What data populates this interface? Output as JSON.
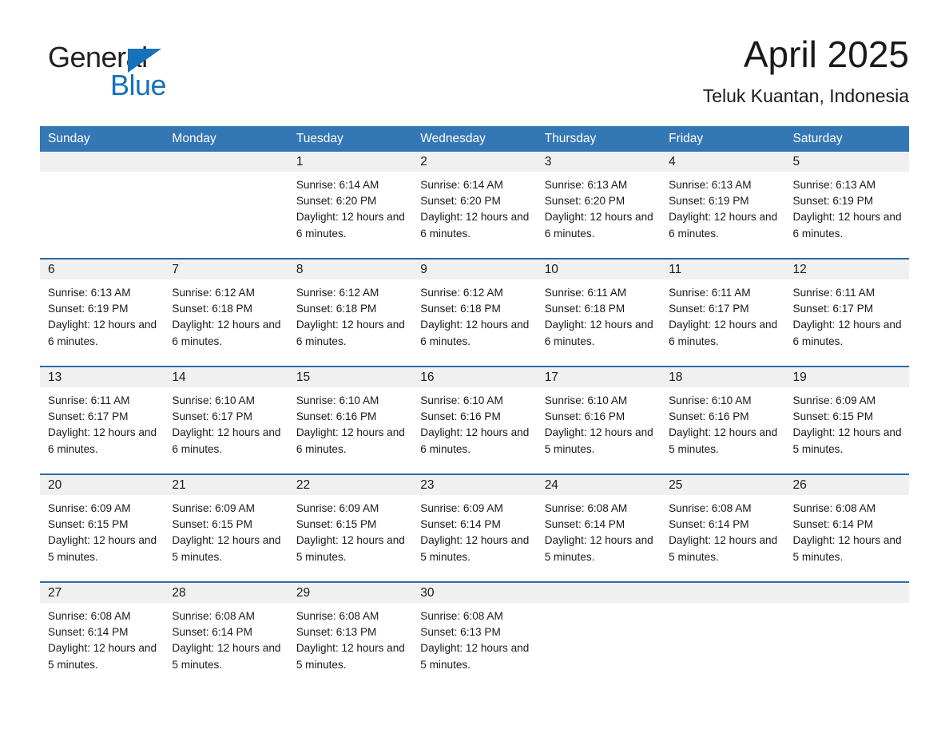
{
  "brand": {
    "name_part1": "General",
    "name_part2": "Blue",
    "triangle_color": "#1572b8",
    "accent_color": "#3477b5"
  },
  "header": {
    "month_title": "April 2025",
    "location": "Teluk Kuantan, Indonesia"
  },
  "calendar": {
    "weekday_headers": [
      "Sunday",
      "Monday",
      "Tuesday",
      "Wednesday",
      "Thursday",
      "Friday",
      "Saturday"
    ],
    "weeks": [
      [
        {
          "empty": true
        },
        {
          "empty": true
        },
        {
          "day": "1",
          "sunrise": "Sunrise: 6:14 AM",
          "sunset": "Sunset: 6:20 PM",
          "daylight": "Daylight: 12 hours and 6 minutes."
        },
        {
          "day": "2",
          "sunrise": "Sunrise: 6:14 AM",
          "sunset": "Sunset: 6:20 PM",
          "daylight": "Daylight: 12 hours and 6 minutes."
        },
        {
          "day": "3",
          "sunrise": "Sunrise: 6:13 AM",
          "sunset": "Sunset: 6:20 PM",
          "daylight": "Daylight: 12 hours and 6 minutes."
        },
        {
          "day": "4",
          "sunrise": "Sunrise: 6:13 AM",
          "sunset": "Sunset: 6:19 PM",
          "daylight": "Daylight: 12 hours and 6 minutes."
        },
        {
          "day": "5",
          "sunrise": "Sunrise: 6:13 AM",
          "sunset": "Sunset: 6:19 PM",
          "daylight": "Daylight: 12 hours and 6 minutes."
        }
      ],
      [
        {
          "day": "6",
          "sunrise": "Sunrise: 6:13 AM",
          "sunset": "Sunset: 6:19 PM",
          "daylight": "Daylight: 12 hours and 6 minutes."
        },
        {
          "day": "7",
          "sunrise": "Sunrise: 6:12 AM",
          "sunset": "Sunset: 6:18 PM",
          "daylight": "Daylight: 12 hours and 6 minutes."
        },
        {
          "day": "8",
          "sunrise": "Sunrise: 6:12 AM",
          "sunset": "Sunset: 6:18 PM",
          "daylight": "Daylight: 12 hours and 6 minutes."
        },
        {
          "day": "9",
          "sunrise": "Sunrise: 6:12 AM",
          "sunset": "Sunset: 6:18 PM",
          "daylight": "Daylight: 12 hours and 6 minutes."
        },
        {
          "day": "10",
          "sunrise": "Sunrise: 6:11 AM",
          "sunset": "Sunset: 6:18 PM",
          "daylight": "Daylight: 12 hours and 6 minutes."
        },
        {
          "day": "11",
          "sunrise": "Sunrise: 6:11 AM",
          "sunset": "Sunset: 6:17 PM",
          "daylight": "Daylight: 12 hours and 6 minutes."
        },
        {
          "day": "12",
          "sunrise": "Sunrise: 6:11 AM",
          "sunset": "Sunset: 6:17 PM",
          "daylight": "Daylight: 12 hours and 6 minutes."
        }
      ],
      [
        {
          "day": "13",
          "sunrise": "Sunrise: 6:11 AM",
          "sunset": "Sunset: 6:17 PM",
          "daylight": "Daylight: 12 hours and 6 minutes."
        },
        {
          "day": "14",
          "sunrise": "Sunrise: 6:10 AM",
          "sunset": "Sunset: 6:17 PM",
          "daylight": "Daylight: 12 hours and 6 minutes."
        },
        {
          "day": "15",
          "sunrise": "Sunrise: 6:10 AM",
          "sunset": "Sunset: 6:16 PM",
          "daylight": "Daylight: 12 hours and 6 minutes."
        },
        {
          "day": "16",
          "sunrise": "Sunrise: 6:10 AM",
          "sunset": "Sunset: 6:16 PM",
          "daylight": "Daylight: 12 hours and 6 minutes."
        },
        {
          "day": "17",
          "sunrise": "Sunrise: 6:10 AM",
          "sunset": "Sunset: 6:16 PM",
          "daylight": "Daylight: 12 hours and 5 minutes."
        },
        {
          "day": "18",
          "sunrise": "Sunrise: 6:10 AM",
          "sunset": "Sunset: 6:16 PM",
          "daylight": "Daylight: 12 hours and 5 minutes."
        },
        {
          "day": "19",
          "sunrise": "Sunrise: 6:09 AM",
          "sunset": "Sunset: 6:15 PM",
          "daylight": "Daylight: 12 hours and 5 minutes."
        }
      ],
      [
        {
          "day": "20",
          "sunrise": "Sunrise: 6:09 AM",
          "sunset": "Sunset: 6:15 PM",
          "daylight": "Daylight: 12 hours and 5 minutes."
        },
        {
          "day": "21",
          "sunrise": "Sunrise: 6:09 AM",
          "sunset": "Sunset: 6:15 PM",
          "daylight": "Daylight: 12 hours and 5 minutes."
        },
        {
          "day": "22",
          "sunrise": "Sunrise: 6:09 AM",
          "sunset": "Sunset: 6:15 PM",
          "daylight": "Daylight: 12 hours and 5 minutes."
        },
        {
          "day": "23",
          "sunrise": "Sunrise: 6:09 AM",
          "sunset": "Sunset: 6:14 PM",
          "daylight": "Daylight: 12 hours and 5 minutes."
        },
        {
          "day": "24",
          "sunrise": "Sunrise: 6:08 AM",
          "sunset": "Sunset: 6:14 PM",
          "daylight": "Daylight: 12 hours and 5 minutes."
        },
        {
          "day": "25",
          "sunrise": "Sunrise: 6:08 AM",
          "sunset": "Sunset: 6:14 PM",
          "daylight": "Daylight: 12 hours and 5 minutes."
        },
        {
          "day": "26",
          "sunrise": "Sunrise: 6:08 AM",
          "sunset": "Sunset: 6:14 PM",
          "daylight": "Daylight: 12 hours and 5 minutes."
        }
      ],
      [
        {
          "day": "27",
          "sunrise": "Sunrise: 6:08 AM",
          "sunset": "Sunset: 6:14 PM",
          "daylight": "Daylight: 12 hours and 5 minutes."
        },
        {
          "day": "28",
          "sunrise": "Sunrise: 6:08 AM",
          "sunset": "Sunset: 6:14 PM",
          "daylight": "Daylight: 12 hours and 5 minutes."
        },
        {
          "day": "29",
          "sunrise": "Sunrise: 6:08 AM",
          "sunset": "Sunset: 6:13 PM",
          "daylight": "Daylight: 12 hours and 5 minutes."
        },
        {
          "day": "30",
          "sunrise": "Sunrise: 6:08 AM",
          "sunset": "Sunset: 6:13 PM",
          "daylight": "Daylight: 12 hours and 5 minutes."
        },
        {
          "empty": true
        },
        {
          "empty": true
        },
        {
          "empty": true
        }
      ]
    ]
  }
}
